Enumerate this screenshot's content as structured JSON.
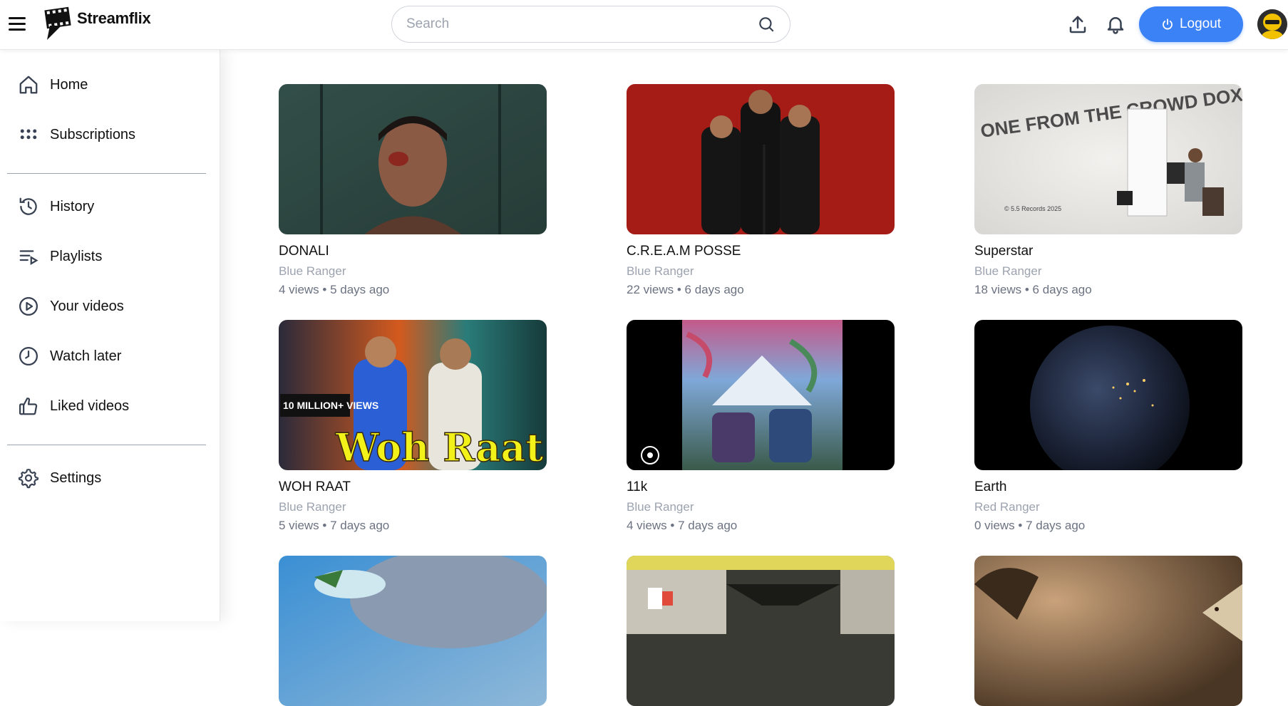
{
  "app": {
    "name": "Streamflix"
  },
  "search": {
    "placeholder": "Search"
  },
  "header": {
    "logout_label": "Logout"
  },
  "sidebar": {
    "items": [
      {
        "label": "Home",
        "icon": "home-icon"
      },
      {
        "label": "Subscriptions",
        "icon": "dots-grid-icon"
      },
      {
        "label": "History",
        "icon": "history-icon"
      },
      {
        "label": "Playlists",
        "icon": "playlist-icon"
      },
      {
        "label": "Your videos",
        "icon": "play-circle-icon"
      },
      {
        "label": "Watch later",
        "icon": "clock-icon"
      },
      {
        "label": "Liked videos",
        "icon": "thumbs-up-icon"
      },
      {
        "label": "Settings",
        "icon": "gear-icon"
      }
    ]
  },
  "videos": [
    {
      "title": "DONALI",
      "channel": "Blue Ranger",
      "meta": "4 views • 5 days ago"
    },
    {
      "title": "C.R.E.A.M POSSE",
      "channel": "Blue Ranger",
      "meta": "22 views • 6 days ago"
    },
    {
      "title": "Superstar",
      "channel": "Blue Ranger",
      "meta": "18 views • 6 days ago",
      "thumb_text": "ONE FROM THE CROWD DOX",
      "thumb_credit": "© 5.5 Records 2025"
    },
    {
      "title": "WOH RAAT",
      "channel": "Blue Ranger",
      "meta": "5 views • 7 days ago",
      "thumb_badge": "10 MILLION+ VIEWS",
      "thumb_text": "Woh Raat"
    },
    {
      "title": "11k",
      "channel": "Blue Ranger",
      "meta": "4 views • 7 days ago"
    },
    {
      "title": "Earth",
      "channel": "Red Ranger",
      "meta": "0 views • 7 days ago"
    },
    {
      "title": "",
      "channel": "",
      "meta": ""
    },
    {
      "title": "",
      "channel": "",
      "meta": ""
    },
    {
      "title": "",
      "channel": "",
      "meta": ""
    }
  ]
}
